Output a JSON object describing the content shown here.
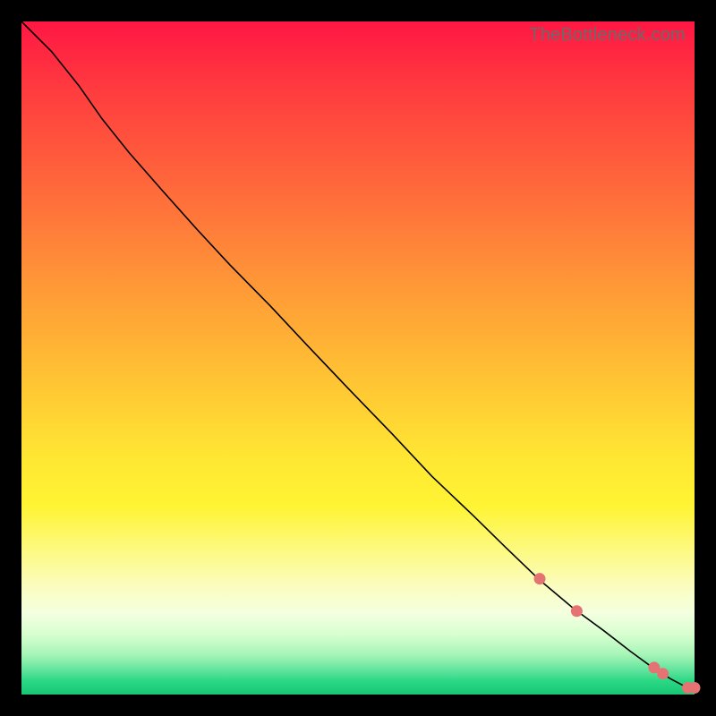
{
  "watermark": "TheBottleneck.com",
  "line": {
    "points": [
      [
        0.0,
        0.0
      ],
      [
        0.045,
        0.045
      ],
      [
        0.085,
        0.095
      ],
      [
        0.12,
        0.145
      ],
      [
        0.16,
        0.195
      ],
      [
        0.21,
        0.252
      ],
      [
        0.26,
        0.308
      ],
      [
        0.31,
        0.362
      ],
      [
        0.37,
        0.423
      ],
      [
        0.43,
        0.487
      ],
      [
        0.49,
        0.55
      ],
      [
        0.55,
        0.612
      ],
      [
        0.61,
        0.676
      ],
      [
        0.67,
        0.733
      ],
      [
        0.72,
        0.782
      ],
      [
        0.77,
        0.83
      ],
      [
        0.82,
        0.872
      ],
      [
        0.865,
        0.905
      ],
      [
        0.905,
        0.936
      ],
      [
        0.942,
        0.963
      ],
      [
        0.965,
        0.977
      ],
      [
        0.982,
        0.986
      ],
      [
        0.995,
        0.99
      ],
      [
        1.0,
        0.99
      ]
    ]
  },
  "markers": [
    {
      "type": "segment",
      "from": [
        0.555,
        0.615
      ],
      "to": [
        0.615,
        0.678
      ]
    },
    {
      "type": "segment",
      "from": [
        0.62,
        0.685
      ],
      "to": [
        0.705,
        0.766
      ]
    },
    {
      "type": "segment",
      "from": [
        0.715,
        0.776
      ],
      "to": [
        0.76,
        0.818
      ]
    },
    {
      "type": "dot",
      "at": [
        0.77,
        0.828
      ]
    },
    {
      "type": "segment",
      "from": [
        0.78,
        0.838
      ],
      "to": [
        0.815,
        0.868
      ]
    },
    {
      "type": "dot",
      "at": [
        0.825,
        0.876
      ]
    },
    {
      "type": "segment",
      "from": [
        0.838,
        0.886
      ],
      "to": [
        0.862,
        0.904
      ]
    },
    {
      "type": "segment",
      "from": [
        0.876,
        0.912
      ],
      "to": [
        0.93,
        0.953
      ]
    },
    {
      "type": "dot",
      "at": [
        0.94,
        0.96
      ]
    },
    {
      "type": "dot",
      "at": [
        0.953,
        0.969
      ]
    },
    {
      "type": "dot",
      "at": [
        0.99,
        0.99
      ]
    },
    {
      "type": "dot",
      "at": [
        1.0,
        0.99
      ]
    }
  ],
  "chart_data": {
    "type": "line",
    "title": "",
    "xlabel": "",
    "ylabel": "",
    "xlim": [
      0,
      1
    ],
    "ylim": [
      0,
      1
    ],
    "series": [
      {
        "name": "curve",
        "x": [
          0.0,
          0.045,
          0.085,
          0.12,
          0.16,
          0.21,
          0.26,
          0.31,
          0.37,
          0.43,
          0.49,
          0.55,
          0.61,
          0.67,
          0.72,
          0.77,
          0.82,
          0.865,
          0.905,
          0.942,
          0.965,
          0.982,
          0.995,
          1.0
        ],
        "y": [
          1.0,
          0.955,
          0.905,
          0.855,
          0.805,
          0.748,
          0.692,
          0.638,
          0.577,
          0.513,
          0.45,
          0.388,
          0.324,
          0.267,
          0.218,
          0.17,
          0.128,
          0.095,
          0.064,
          0.037,
          0.023,
          0.014,
          0.01,
          0.01
        ]
      }
    ],
    "highlighted_x_ranges": [
      [
        0.555,
        0.615
      ],
      [
        0.62,
        0.705
      ],
      [
        0.715,
        0.76
      ],
      [
        0.77,
        0.77
      ],
      [
        0.78,
        0.815
      ],
      [
        0.825,
        0.825
      ],
      [
        0.838,
        0.862
      ],
      [
        0.876,
        0.93
      ],
      [
        0.94,
        0.94
      ],
      [
        0.953,
        0.953
      ],
      [
        0.99,
        0.99
      ],
      [
        1.0,
        1.0
      ]
    ],
    "background": "vertical-gradient red→orange→yellow→pale→green",
    "grid": false,
    "legend": false
  }
}
